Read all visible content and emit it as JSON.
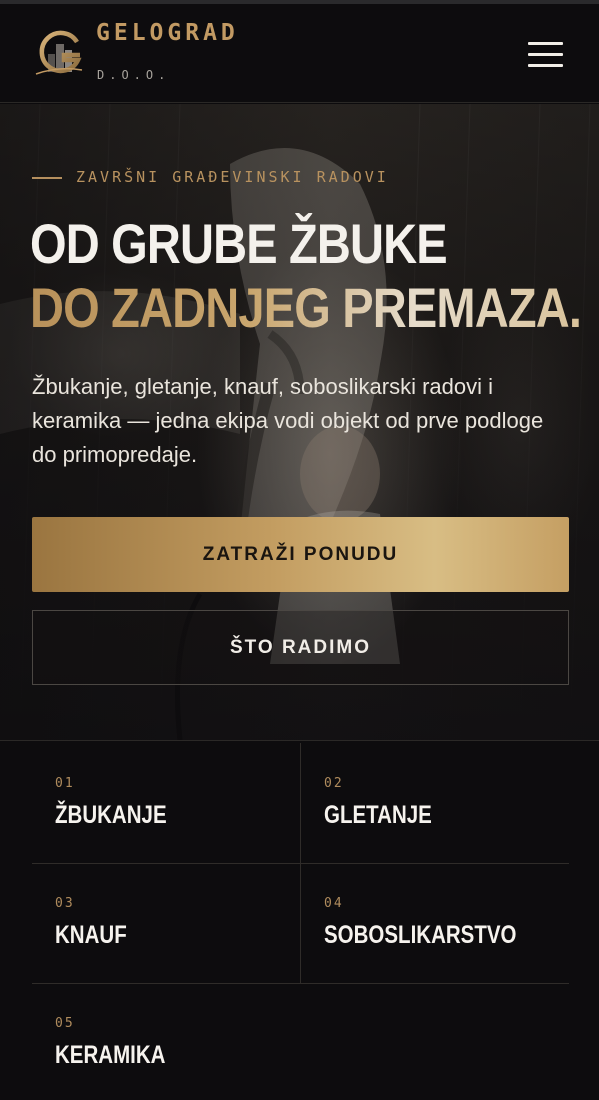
{
  "header": {
    "brand_name": "GELOGRAD",
    "brand_sub": "D.O.O.",
    "logo_letter": "G",
    "menu_icon": "hamburger-menu-icon"
  },
  "hero": {
    "eyebrow": "ZAVRŠNI GRAĐEVINSKI RADOVI",
    "title_line1": "OD GRUBE ŽBUKE",
    "title_line2": "DO ZADNJEG PREMAZA.",
    "lead": "Žbukanje, gletanje, knauf, soboslikarski radovi i keramika — jedna ekipa vodi objekt od prve podloge do primopredaje.",
    "primary_cta": "ZATRAŽI PONUDU",
    "secondary_cta": "ŠTO RADIMO"
  },
  "services": [
    {
      "num": "01",
      "name": "ŽBUKANJE"
    },
    {
      "num": "02",
      "name": "GLETANJE"
    },
    {
      "num": "03",
      "name": "KNAUF"
    },
    {
      "num": "04",
      "name": "SOBOSLIKARSTVO"
    },
    {
      "num": "05",
      "name": "KERAMIKA"
    }
  ],
  "colors": {
    "accent_gold": "#c29a63",
    "background": "#0c0b0d",
    "text_light": "#f4f1ec"
  }
}
